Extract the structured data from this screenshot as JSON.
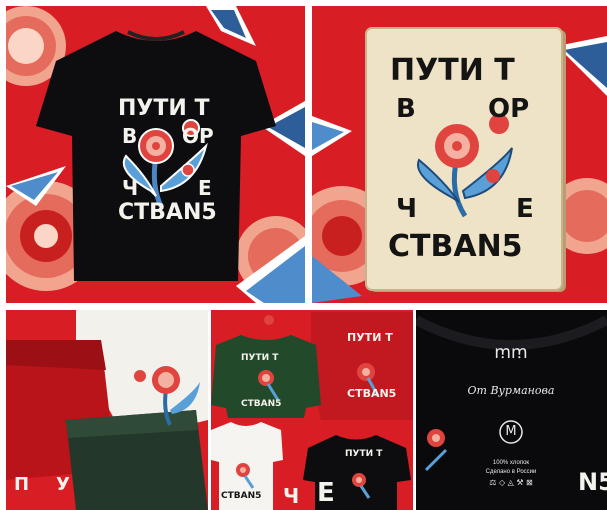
{
  "artwork": {
    "line1": "ПУТИ Т",
    "line2a": "В",
    "line2b": "ОР",
    "line3a": "Ч",
    "line3b": "Е",
    "line4": "СТВАN5"
  },
  "fabric_detail": {
    "letter_a": "П",
    "letter_b": "У"
  },
  "lineup_detail": {
    "letter_a": "Ч",
    "letter_b": "Е"
  },
  "neck_label": {
    "brand_mark": "ꭑꭑ",
    "signature": "От Вурманова",
    "size": "M",
    "composition": "100% хлопок",
    "origin": "Сделано в России",
    "care_icons": "⚖ ◇ ◬ ⚒ ⊠",
    "edge_letters": "N5"
  },
  "colors": {
    "background_red": "#d81d24",
    "tee_black": "#0d0d10",
    "book_paper": "#efe3c7",
    "sweater_green": "#23492b",
    "flower_red": "#e0443f",
    "leaf_blue": "#5aa0d8"
  }
}
